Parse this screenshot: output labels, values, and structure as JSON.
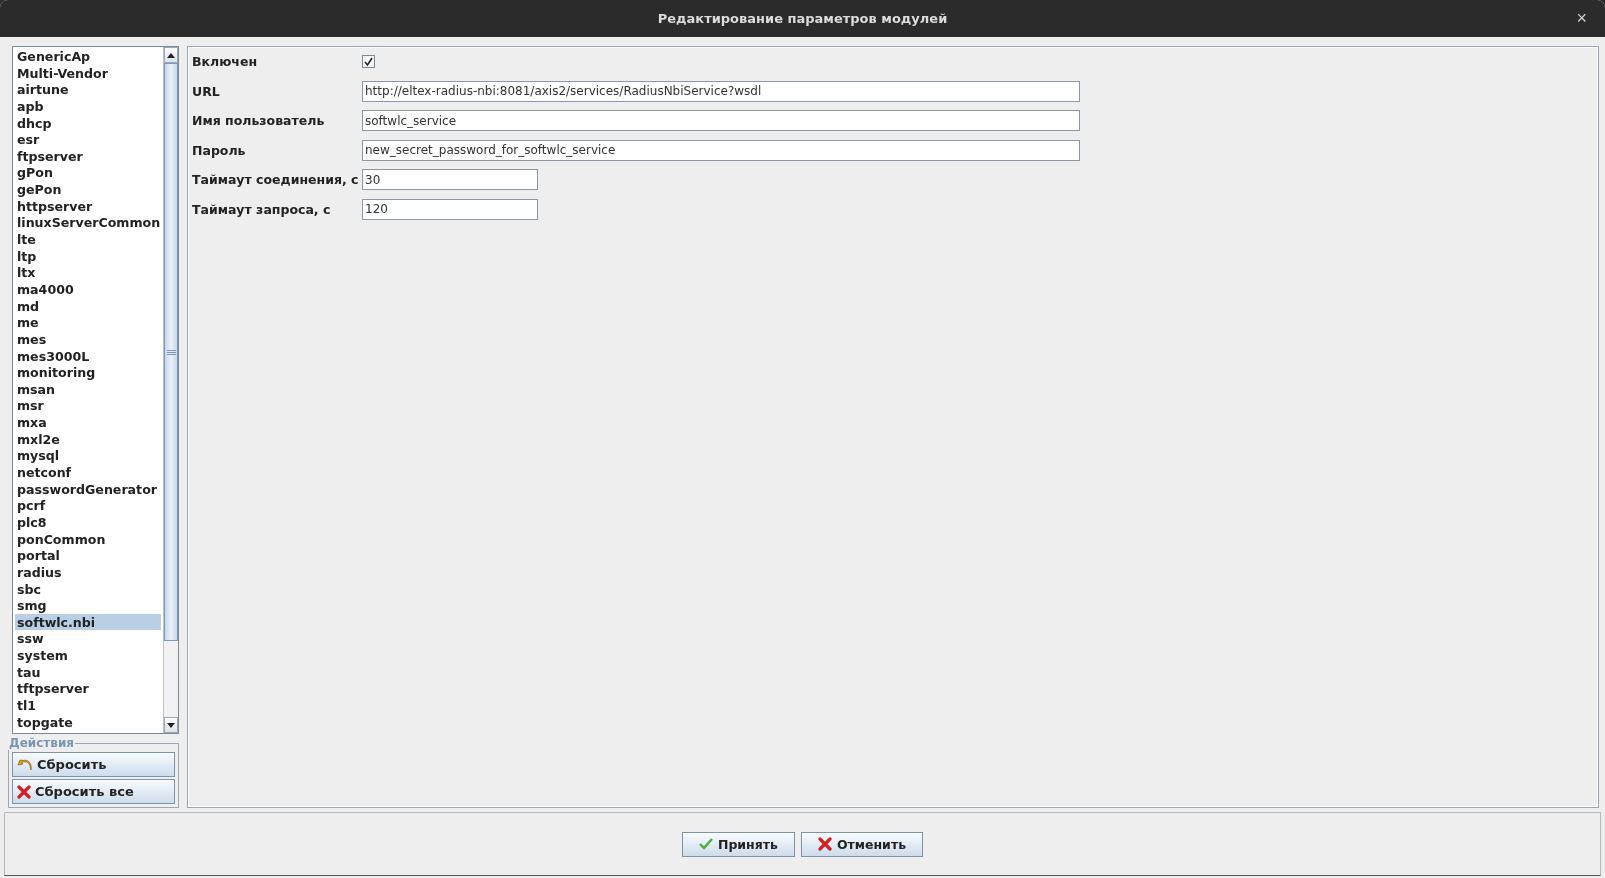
{
  "window": {
    "title": "Редактирование параметров модулей",
    "close": "×"
  },
  "modules": [
    {
      "label": "GenericAp",
      "selected": false
    },
    {
      "label": "Multi-Vendor",
      "selected": false
    },
    {
      "label": "airtune",
      "selected": false
    },
    {
      "label": "apb",
      "selected": false
    },
    {
      "label": "dhcp",
      "selected": false
    },
    {
      "label": "esr",
      "selected": false
    },
    {
      "label": "ftpserver",
      "selected": false
    },
    {
      "label": "gPon",
      "selected": false
    },
    {
      "label": "gePon",
      "selected": false
    },
    {
      "label": "httpserver",
      "selected": false
    },
    {
      "label": "linuxServerCommon",
      "selected": false
    },
    {
      "label": "lte",
      "selected": false
    },
    {
      "label": "ltp",
      "selected": false
    },
    {
      "label": "ltx",
      "selected": false
    },
    {
      "label": "ma4000",
      "selected": false
    },
    {
      "label": "md",
      "selected": false
    },
    {
      "label": "me",
      "selected": false
    },
    {
      "label": "mes",
      "selected": false
    },
    {
      "label": "mes3000L",
      "selected": false
    },
    {
      "label": "monitoring",
      "selected": false
    },
    {
      "label": "msan",
      "selected": false
    },
    {
      "label": "msr",
      "selected": false
    },
    {
      "label": "mxa",
      "selected": false
    },
    {
      "label": "mxl2e",
      "selected": false
    },
    {
      "label": "mysql",
      "selected": false
    },
    {
      "label": "netconf",
      "selected": false
    },
    {
      "label": "passwordGenerator",
      "selected": false
    },
    {
      "label": "pcrf",
      "selected": false
    },
    {
      "label": "plc8",
      "selected": false
    },
    {
      "label": "ponCommon",
      "selected": false
    },
    {
      "label": "portal",
      "selected": false
    },
    {
      "label": "radius",
      "selected": false
    },
    {
      "label": "sbc",
      "selected": false
    },
    {
      "label": "smg",
      "selected": false
    },
    {
      "label": "softwlc.nbi",
      "selected": true
    },
    {
      "label": "ssw",
      "selected": false
    },
    {
      "label": "system",
      "selected": false
    },
    {
      "label": "tau",
      "selected": false
    },
    {
      "label": "tftpserver",
      "selected": false
    },
    {
      "label": "tl1",
      "selected": false
    },
    {
      "label": "topgate",
      "selected": false
    }
  ],
  "actions": {
    "title": "Действия",
    "buttons": [
      {
        "kind": "reset",
        "label": "Сбросить"
      },
      {
        "kind": "reset_all",
        "label": "Сбросить все"
      }
    ]
  },
  "parameters": [
    {
      "kind": "checkbox",
      "label": "Включен",
      "checked": true
    },
    {
      "kind": "wide",
      "label": "URL",
      "value": "http://eltex-radius-nbi:8081/axis2/services/RadiusNbiService?wsdl"
    },
    {
      "kind": "wide",
      "label": "Имя пользователь",
      "value": "softwlc_service"
    },
    {
      "kind": "wide",
      "label": "Пароль",
      "value": "new_secret_password_for_softwlc_service"
    },
    {
      "kind": "short",
      "label": "Таймаут соединения, с",
      "value": "30"
    },
    {
      "kind": "short",
      "label": "Таймаут запроса, с",
      "value": "120"
    }
  ],
  "footer": [
    {
      "kind": "accept",
      "label": "Принять"
    },
    {
      "kind": "cancel",
      "label": "Отменить"
    }
  ]
}
